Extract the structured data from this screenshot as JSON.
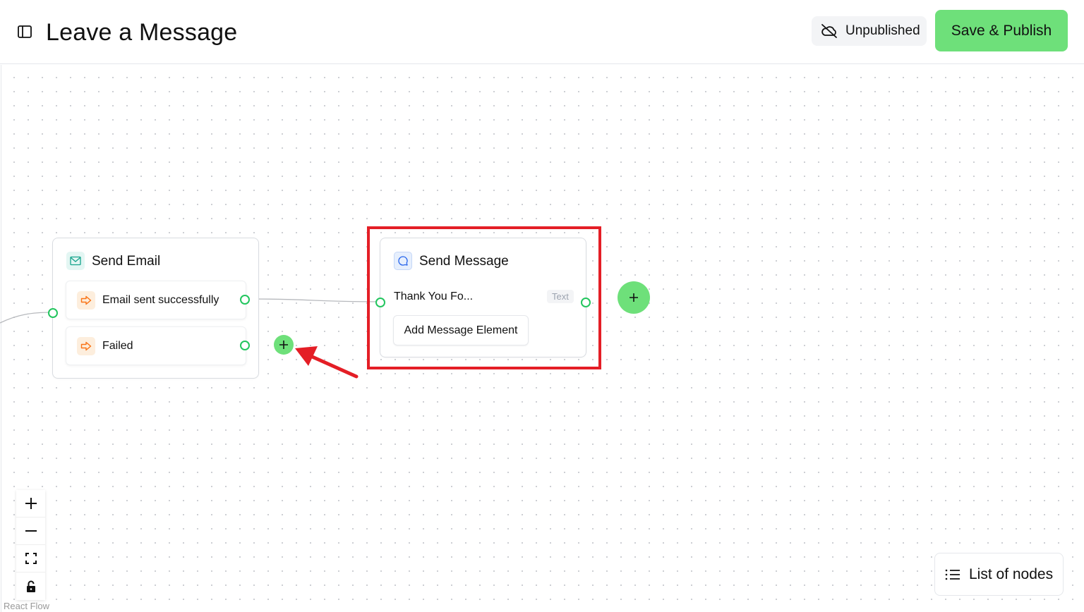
{
  "header": {
    "title": "Leave a Message",
    "sidebar_toggle_icon": "sidebar-icon",
    "status_label": "Unpublished",
    "status_icon": "cloud-off-icon",
    "publish_label": "Save & Publish",
    "publish_color": "#6ee07a"
  },
  "nodes": {
    "send_email": {
      "title": "Send Email",
      "icon": "mail-icon",
      "branches": [
        {
          "label": "Email sent successfully",
          "icon": "arrow-right-icon"
        },
        {
          "label": "Failed",
          "icon": "arrow-right-icon"
        }
      ]
    },
    "send_message": {
      "title": "Send Message",
      "icon": "message-circle-icon",
      "element_text": "Thank You Fo...",
      "element_type": "Text",
      "add_element_label": "Add Message Element"
    }
  },
  "controls": {
    "zoom_in": "plus-icon",
    "zoom_out": "minus-icon",
    "fit_view": "fit-view-icon",
    "lock": "lock-icon"
  },
  "attribution": "React Flow",
  "list_nodes_label": "List of nodes",
  "colors": {
    "accent": "#6ee07a",
    "handle": "#22c55e",
    "highlight": "#e41e26",
    "branch_icon_bg": "#fdeedd",
    "branch_icon": "#f97316"
  }
}
